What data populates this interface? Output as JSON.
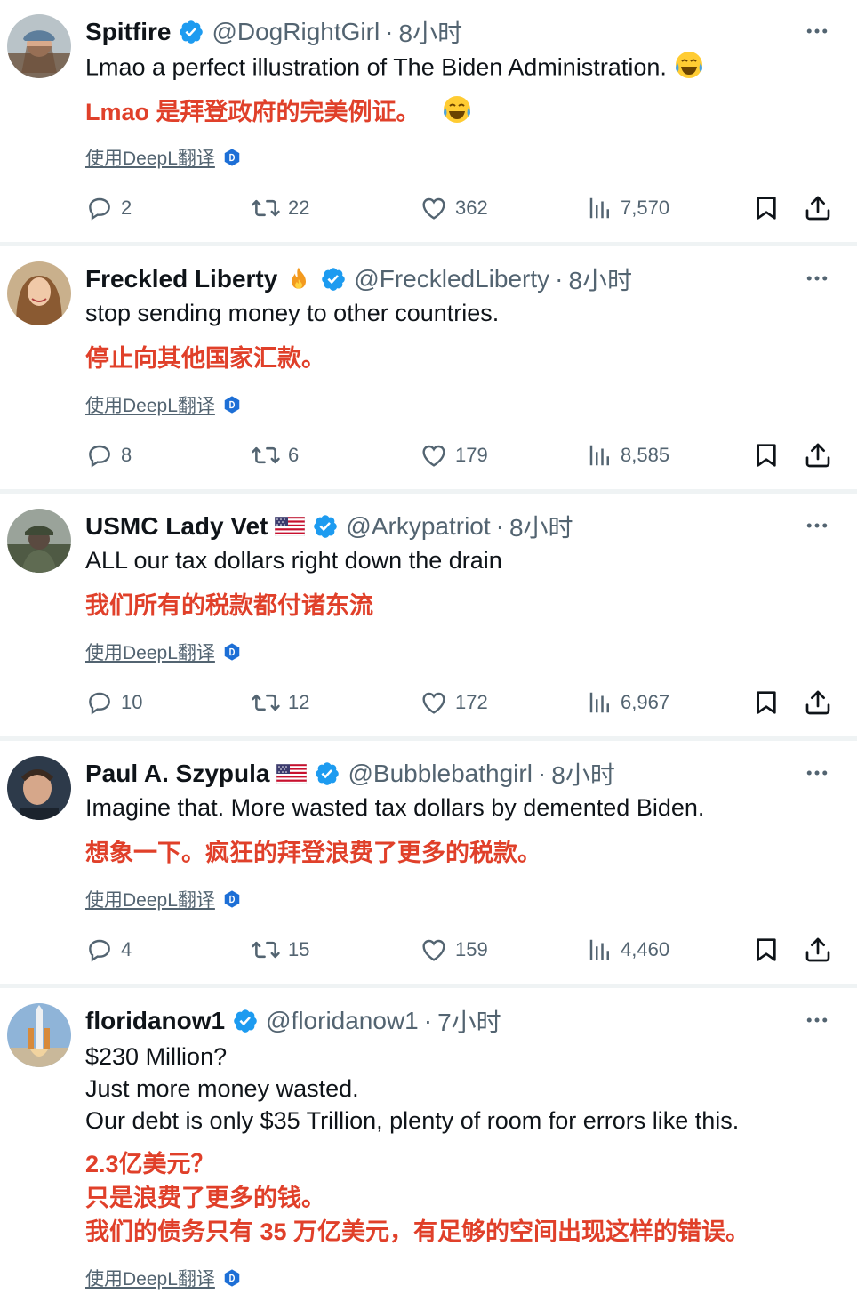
{
  "translate_label": "使用DeepL翻译",
  "colors": {
    "accent_blue": "#1d9bf0",
    "translation_red": "#e0402a",
    "muted": "#536471"
  },
  "tweets": [
    {
      "name": "Spitfire",
      "handle": "@DogRightGirl",
      "sep": "·",
      "time": "8小时",
      "text_lines": [
        "Lmao a perfect illustration of The Biden Administration."
      ],
      "translation_lines": [
        "Lmao 是拜登政府的完美例证。"
      ],
      "emoji": "😂",
      "replies": "2",
      "reposts": "22",
      "likes": "362",
      "views": "7,570"
    },
    {
      "name": "Freckled Liberty",
      "handle": "@FreckledLiberty",
      "sep": "·",
      "time": "8小时",
      "text_lines": [
        "stop sending money to other countries."
      ],
      "translation_lines": [
        "停止向其他国家汇款。"
      ],
      "replies": "8",
      "reposts": "6",
      "likes": "179",
      "views": "8,585"
    },
    {
      "name": "USMC Lady Vet",
      "handle": "@Arkypatriot",
      "sep": "·",
      "time": "8小时",
      "text_lines": [
        "ALL our tax dollars right down the drain"
      ],
      "translation_lines": [
        "我们所有的税款都付诸东流"
      ],
      "replies": "10",
      "reposts": "12",
      "likes": "172",
      "views": "6,967"
    },
    {
      "name": "Paul A. Szypula",
      "handle": "@Bubblebathgirl",
      "sep": "·",
      "time": "8小时",
      "text_lines": [
        "Imagine that. More wasted tax dollars by demented Biden."
      ],
      "translation_lines": [
        "想象一下。疯狂的拜登浪费了更多的税款。"
      ],
      "replies": "4",
      "reposts": "15",
      "likes": "159",
      "views": "4,460"
    },
    {
      "name": "floridanow1",
      "handle": "@floridanow1",
      "sep": "·",
      "time": "7小时",
      "text_lines": [
        "$230 Million?",
        "Just more money wasted.",
        "Our debt is only $35 Trillion, plenty of room for errors like this."
      ],
      "translation_lines": [
        "2.3亿美元？",
        "只是浪费了更多的钱。",
        "我们的债务只有 35 万亿美元，有足够的空间出现这样的错误。"
      ]
    }
  ]
}
